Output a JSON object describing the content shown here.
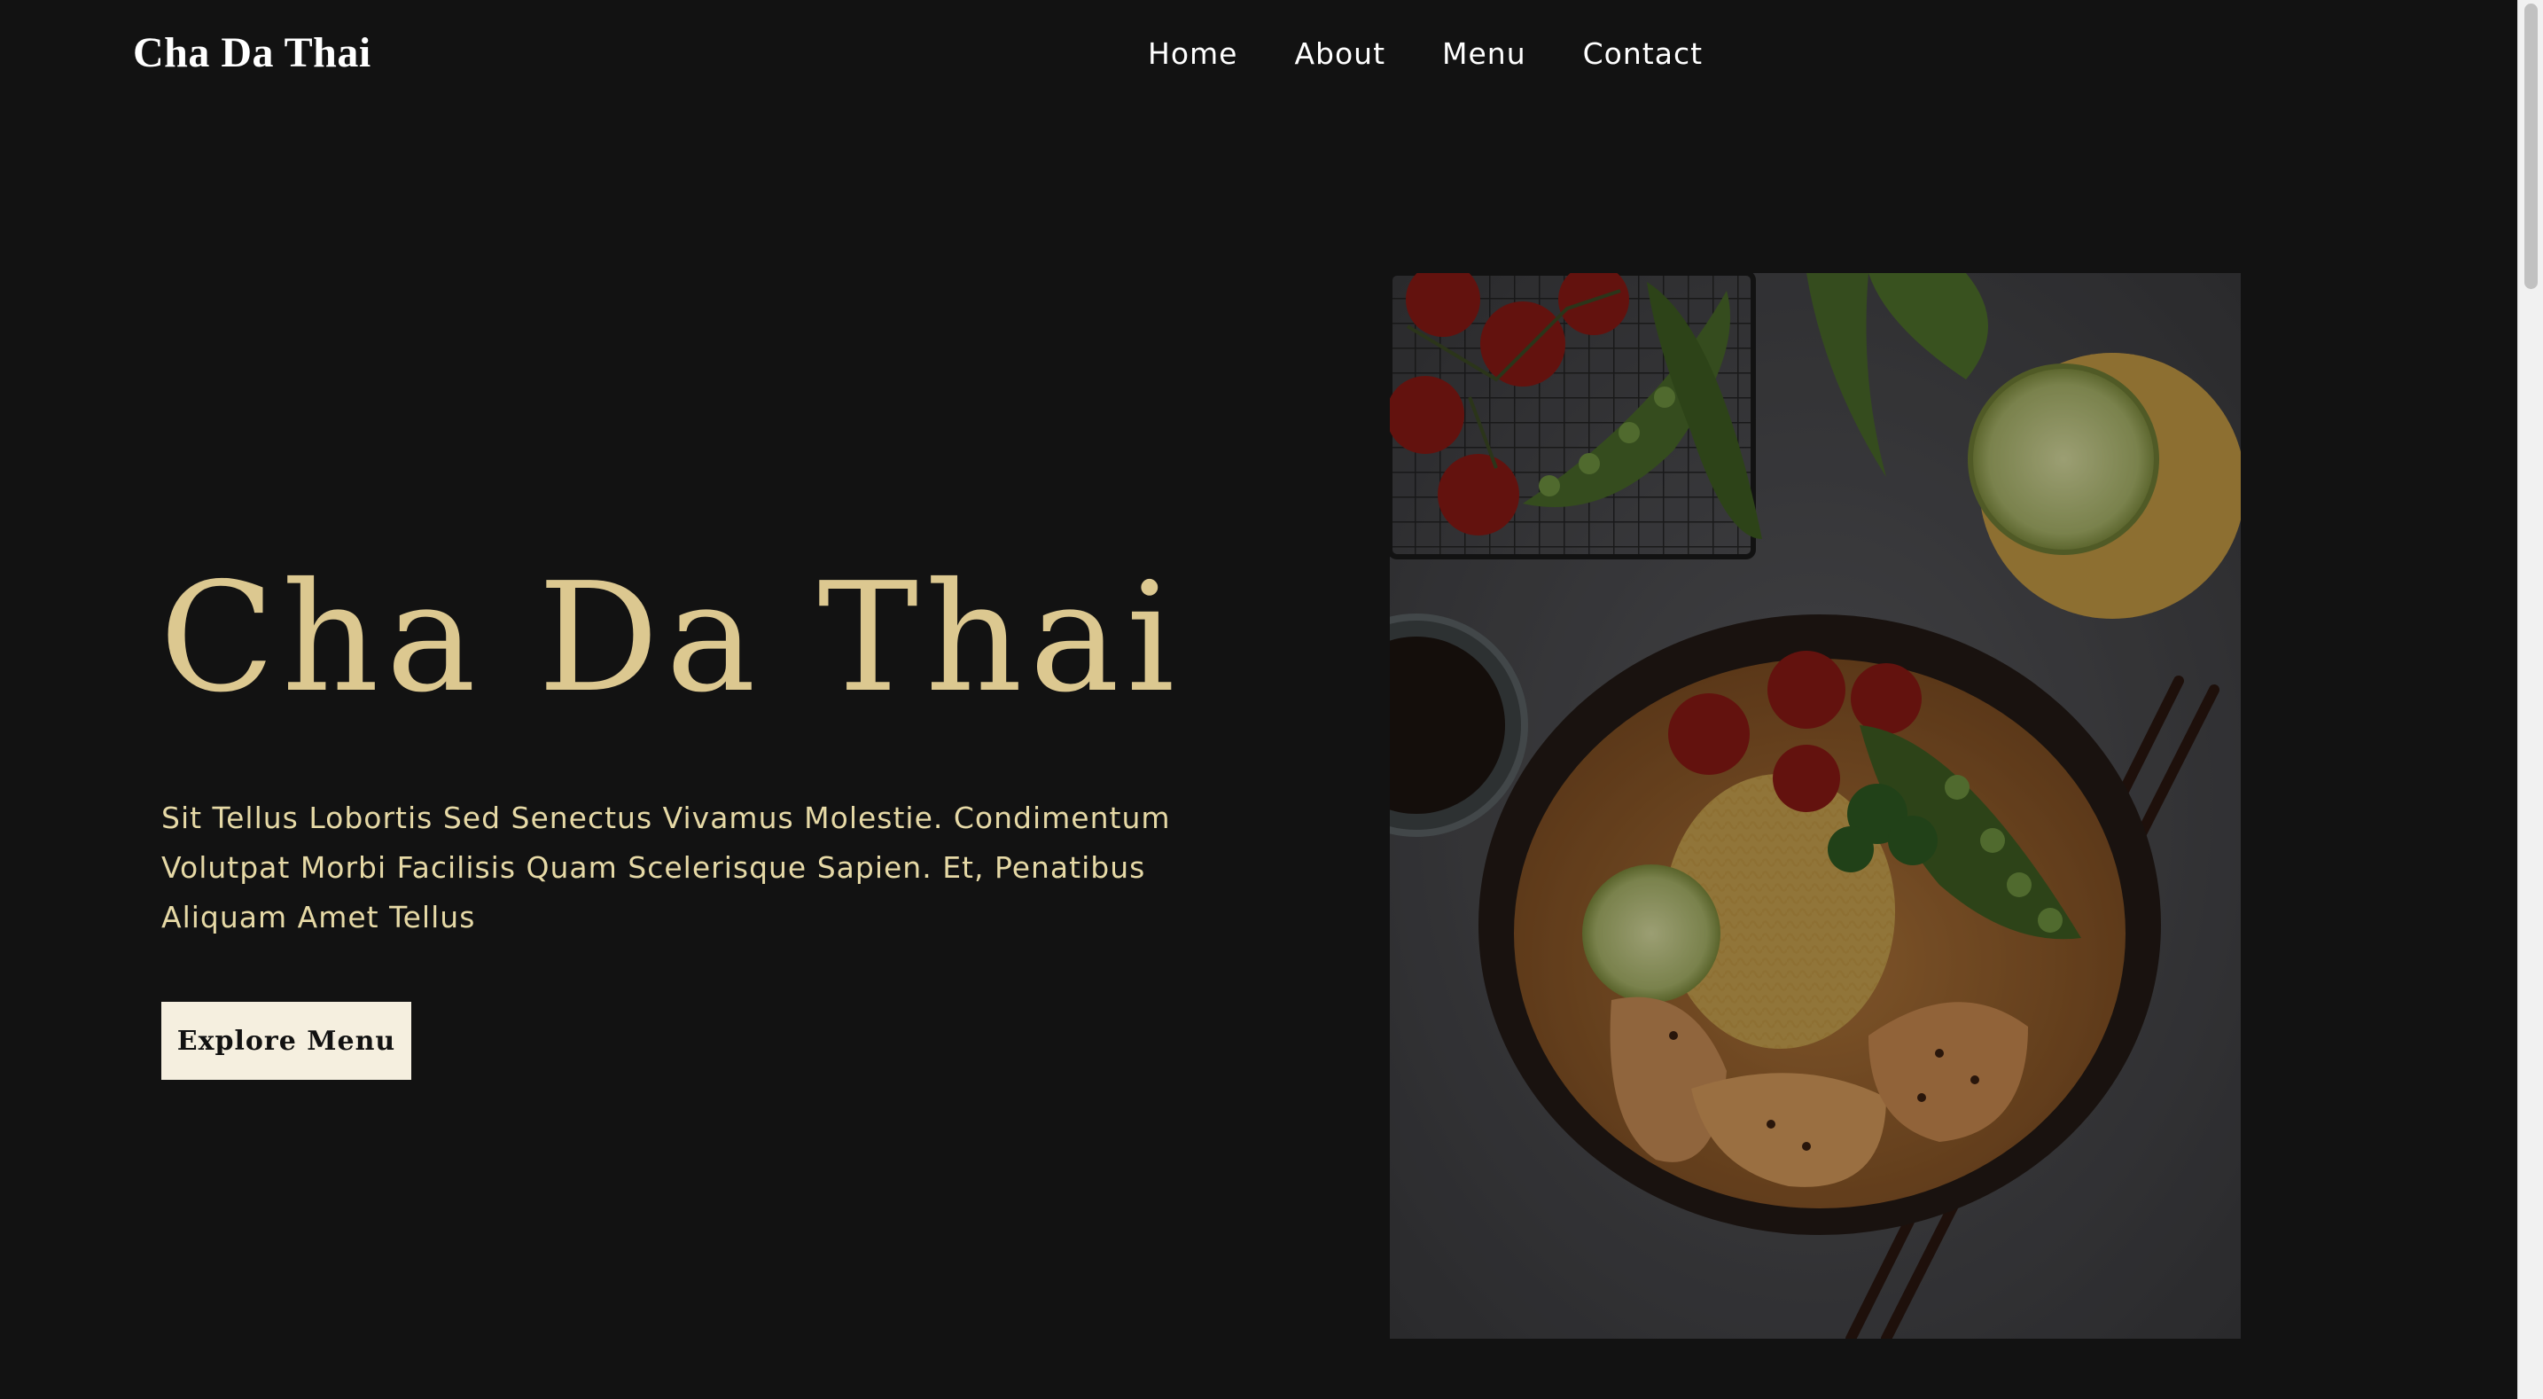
{
  "header": {
    "brand": "Cha Da Thai",
    "nav": [
      {
        "label": "Home"
      },
      {
        "label": "About"
      },
      {
        "label": "Menu"
      },
      {
        "label": "Contact"
      }
    ]
  },
  "hero": {
    "title": "Cha Da Thai",
    "description": "Sit Tellus Lobortis Sed Senectus Vivamus Molestie. Condimentum Volutpat Morbi Facilisis Quam Scelerisque Sapien. Et, Penatibus Aliquam Amet Tellus",
    "cta_label": "Explore Menu",
    "image": {
      "subject": "thai-curry-noodle-bowl"
    }
  },
  "colors": {
    "background": "#121212",
    "accent_gold": "#dcc890",
    "button_bg": "#f5efdf",
    "nav_text": "#ffffff"
  }
}
